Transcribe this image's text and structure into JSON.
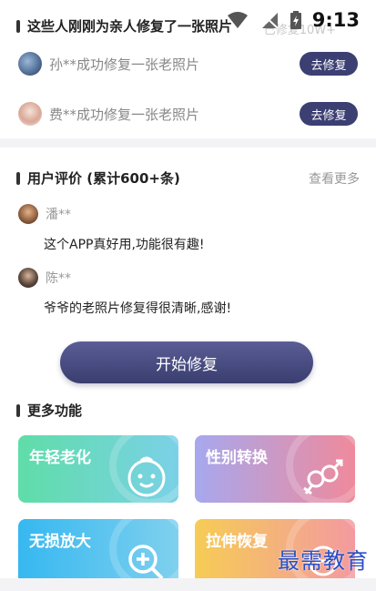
{
  "status": {
    "time": "9:13",
    "overlay_text": "已修复10W+"
  },
  "recent": {
    "title": "这些人刚刚为亲人修复了一张照片",
    "items": [
      {
        "text": "孙**成功修复一张老照片",
        "button": "去修复"
      },
      {
        "text": "费**成功修复一张老照片",
        "button": "去修复"
      }
    ]
  },
  "reviews": {
    "title": "用户评价 (累计600+条)",
    "more": "查看更多",
    "items": [
      {
        "name": "潘**",
        "text": "这个APP真好用,功能很有趣!"
      },
      {
        "name": "陈**",
        "text": "爷爷的老照片修复得很清晰,感谢!"
      }
    ]
  },
  "start_button": "开始修复",
  "more_features": {
    "title": "更多功能",
    "cards": [
      {
        "label": "年轻老化",
        "icon": "baby-face-icon"
      },
      {
        "label": "性别转换",
        "icon": "gender-icon"
      },
      {
        "label": "无损放大",
        "icon": "zoom-in-icon"
      },
      {
        "label": "拉伸恢复",
        "icon": "stretch-icon"
      }
    ]
  },
  "watermark": "最需教育",
  "colors": {
    "accent": "#3b3f72",
    "divider": "#f3f3f5"
  }
}
